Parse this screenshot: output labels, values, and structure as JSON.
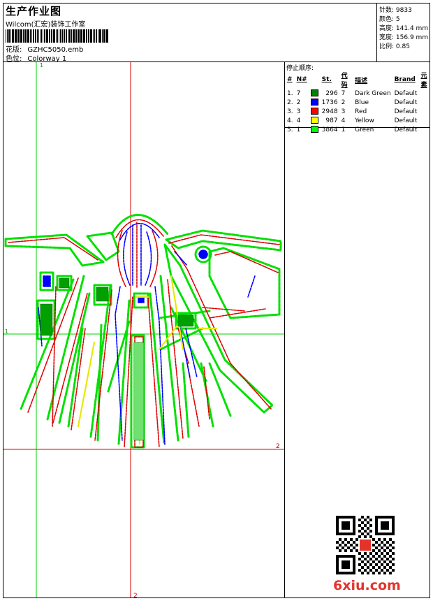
{
  "header": {
    "title": "生产作业图",
    "company": "Wilcom(汇宏)装饰工作室",
    "design_label": "花版:",
    "design_value": "GZHC5050.emb",
    "color_label": "色位:",
    "color_value": "Colorway 1"
  },
  "stats": [
    {
      "label": "针数",
      "value": "9833"
    },
    {
      "label": "颜色",
      "value": "5"
    },
    {
      "label": "高度",
      "value": "141.4 mm"
    },
    {
      "label": "宽度",
      "value": "156.9 mm"
    },
    {
      "label": "比例",
      "value": "0.85"
    }
  ],
  "stop_sequence": {
    "title": "停止顺序:",
    "headers": [
      "#",
      "N#",
      "St.",
      "代码",
      "描述",
      "Brand",
      "元素"
    ],
    "rows": [
      {
        "idx": "1.",
        "n": "7",
        "color": "#008000",
        "st": "296",
        "code": "7",
        "desc": "Dark Green",
        "brand": "Default"
      },
      {
        "idx": "2.",
        "n": "2",
        "color": "#0000ff",
        "st": "1736",
        "code": "2",
        "desc": "Blue",
        "brand": "Default"
      },
      {
        "idx": "3.",
        "n": "3",
        "color": "#ff0000",
        "st": "2948",
        "code": "3",
        "desc": "Red",
        "brand": "Default"
      },
      {
        "idx": "4.",
        "n": "4",
        "color": "#ffff00",
        "st": "987",
        "code": "4",
        "desc": "Yellow",
        "brand": "Default"
      },
      {
        "idx": "5.",
        "n": "1",
        "color": "#00ff00",
        "st": "3864",
        "code": "1",
        "desc": "Green",
        "brand": "Default"
      }
    ]
  },
  "guides": {
    "top": "1",
    "left": "1",
    "right": "2",
    "bottom": "2"
  },
  "watermark": "6xiu.com",
  "colors": {
    "green": "#00e000",
    "red": "#e00000",
    "blue": "#0000ff",
    "yellow": "#f0f000",
    "dark_green": "#009000"
  }
}
